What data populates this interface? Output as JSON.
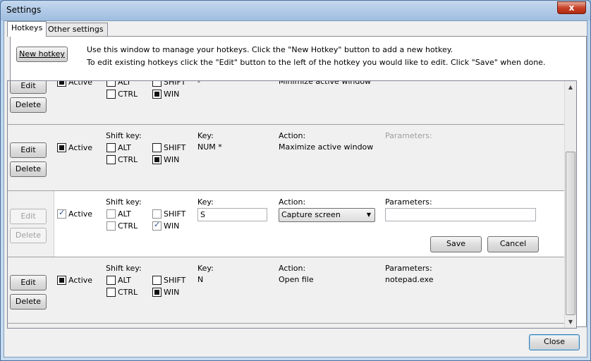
{
  "window": {
    "title": "Settings",
    "close_glyph": "x"
  },
  "tabs": [
    {
      "label": "Hotkeys"
    },
    {
      "label": "Other settings"
    }
  ],
  "toolbar": {
    "new_hotkey_label": "New hotkey",
    "info_line1": "Use this window to manage your hotkeys. Click the \"New Hotkey\" button to add a new hotkey.",
    "info_line2": "To edit existing hotkeys click the \"Edit\" button to the left of the hotkey you would like to edit. Click \"Save\" when done."
  },
  "labels": {
    "edit": "Edit",
    "delete": "Delete",
    "active": "Active",
    "shift_key": "Shift key:",
    "alt": "ALT",
    "ctrl": "CTRL",
    "shift": "SHIFT",
    "win": "WIN",
    "key": "Key:",
    "action": "Action:",
    "parameters": "Parameters:",
    "save": "Save",
    "cancel": "Cancel"
  },
  "hotkeys": [
    {
      "active": true,
      "alt": false,
      "ctrl": false,
      "shift": false,
      "win": true,
      "key": "-",
      "action": "Minimize active window",
      "parameters": ""
    },
    {
      "active": true,
      "alt": false,
      "ctrl": false,
      "shift": false,
      "win": true,
      "key": "NUM *",
      "action": "Maximize active window",
      "parameters": ""
    },
    {
      "active": true,
      "alt": false,
      "ctrl": false,
      "shift": false,
      "win": true,
      "key": "S",
      "action": "Capture screen",
      "parameters": "",
      "editing": true
    },
    {
      "active": true,
      "alt": false,
      "ctrl": false,
      "shift": false,
      "win": true,
      "key": "N",
      "action": "Open file",
      "parameters": "notepad.exe"
    }
  ],
  "footer": {
    "close_label": "Close"
  }
}
